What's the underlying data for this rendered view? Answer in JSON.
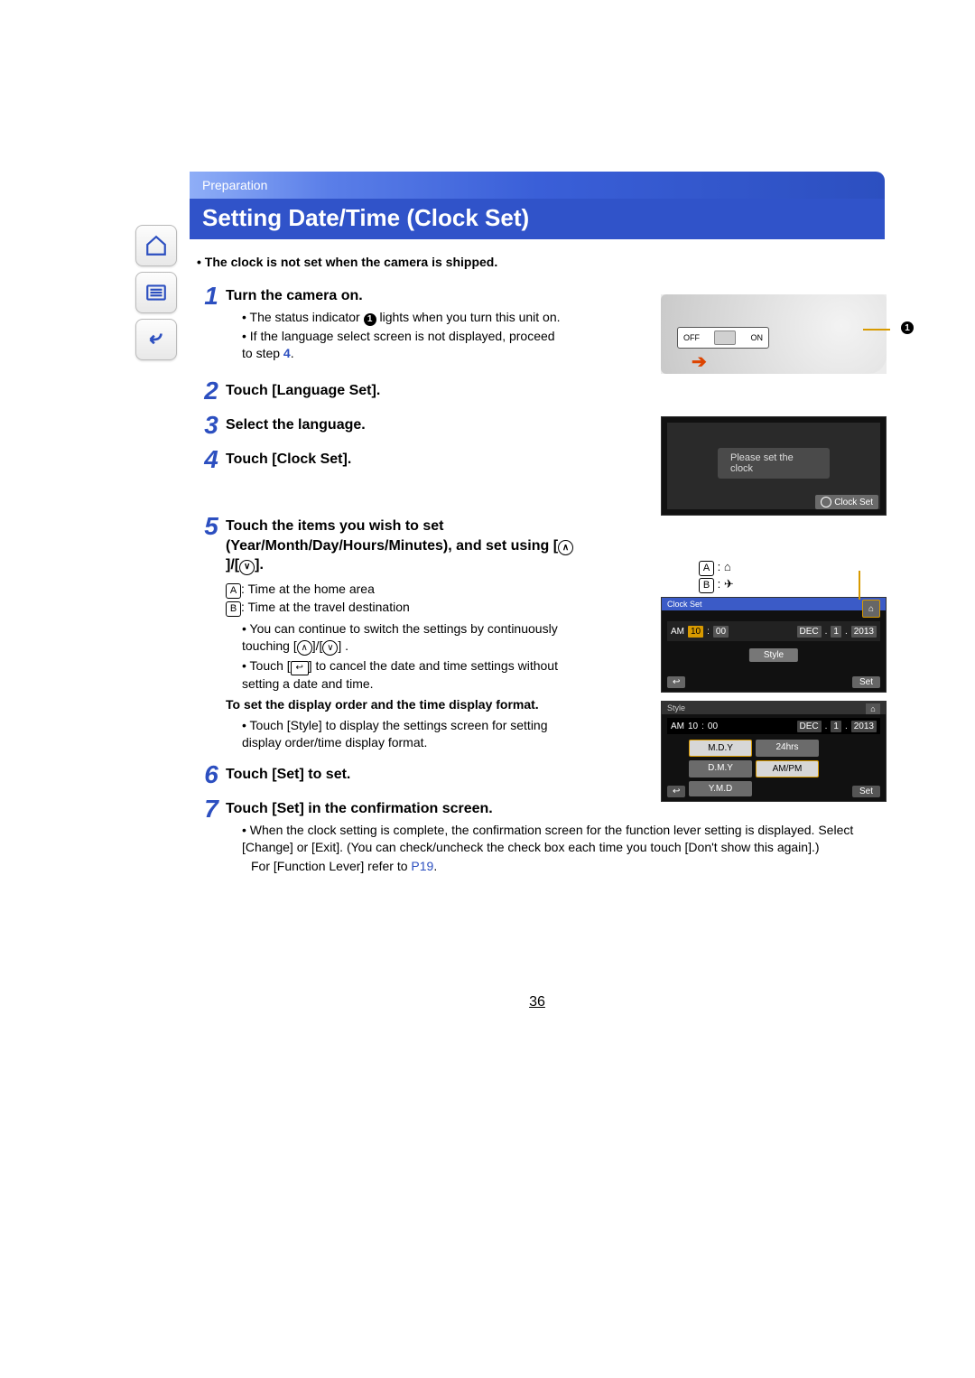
{
  "header": {
    "category": "Preparation",
    "title": "Setting Date/Time (Clock Set)"
  },
  "intro_note": "The clock is not set when the camera is shipped.",
  "nav": {
    "home": "home-icon",
    "menu": "menu-icon",
    "back": "back-icon"
  },
  "steps": [
    {
      "num": "1",
      "head": "Turn the camera on.",
      "bullets": [
        {
          "pre": "The status indicator ",
          "badge": "1",
          "post": " lights when you turn this unit on."
        },
        {
          "pre": "If the language select screen is not displayed, proceed to step ",
          "link": "4",
          "post": "."
        }
      ]
    },
    {
      "num": "2",
      "head": "Touch [Language Set]."
    },
    {
      "num": "3",
      "head": "Select the language."
    },
    {
      "num": "4",
      "head": "Touch [Clock Set]."
    },
    {
      "num": "5",
      "head_pre": "Touch the items you wish to set (Year/Month/Day/Hours/Minutes), and set using [",
      "head_mid": "]/[",
      "head_post": "].",
      "legend": [
        {
          "letter": "A",
          "text": ": Time at the home area"
        },
        {
          "letter": "B",
          "text": ": Time at the travel destination"
        }
      ],
      "bullets2": [
        {
          "pre": "You can continue to switch the settings by continuously touching [",
          "mid": "]/[",
          "post": "] ."
        },
        {
          "pre": "Touch [",
          "icon": "back",
          "post": "] to cancel the date and time settings without setting a date and time."
        }
      ],
      "subhead": "To set the display order and the time display format.",
      "sub_bullet": "Touch [Style] to display the settings screen for setting display order/time display format."
    },
    {
      "num": "6",
      "head": "Touch [Set] to set."
    },
    {
      "num": "7",
      "head": "Touch [Set] in the confirmation screen.",
      "bullets": [
        {
          "text": "When the clock setting is complete, the confirmation screen for the function lever setting is displayed. Select [Change] or [Exit]. (You can check/uncheck the check box each time you touch [Don't show this again].)"
        }
      ],
      "tail_pre": "For [Function Lever] refer to ",
      "tail_link": "P19",
      "tail_post": "."
    }
  ],
  "figures": {
    "f1": {
      "off": "OFF",
      "on": "ON",
      "badge": "1"
    },
    "f2": {
      "msg": "Please set the clock",
      "btn": "Clock Set"
    },
    "f3": {
      "legendA": "A",
      "legendA_icon": "⌂",
      "legendB": "B",
      "legendB_icon": "✈",
      "bar": "Clock Set",
      "am": "AM",
      "h": "10",
      "m": "00",
      "mon": "DEC",
      "sep": ".",
      "d": "1",
      "sep2": ".",
      "y": "2013",
      "style": "Style",
      "back": "↩",
      "set": "Set"
    },
    "f4": {
      "bar": "Style",
      "am": "AM",
      "h": "10",
      "m": "00",
      "mon": "DEC",
      "sep": ".",
      "d": "1",
      "sep2": ".",
      "y": "2013",
      "b1": "M.D.Y",
      "b2": "24hrs",
      "b3": "D.M.Y",
      "b4": "AM/PM",
      "b5": "Y.M.D",
      "back": "↩",
      "set": "Set"
    }
  },
  "page_number": "36"
}
